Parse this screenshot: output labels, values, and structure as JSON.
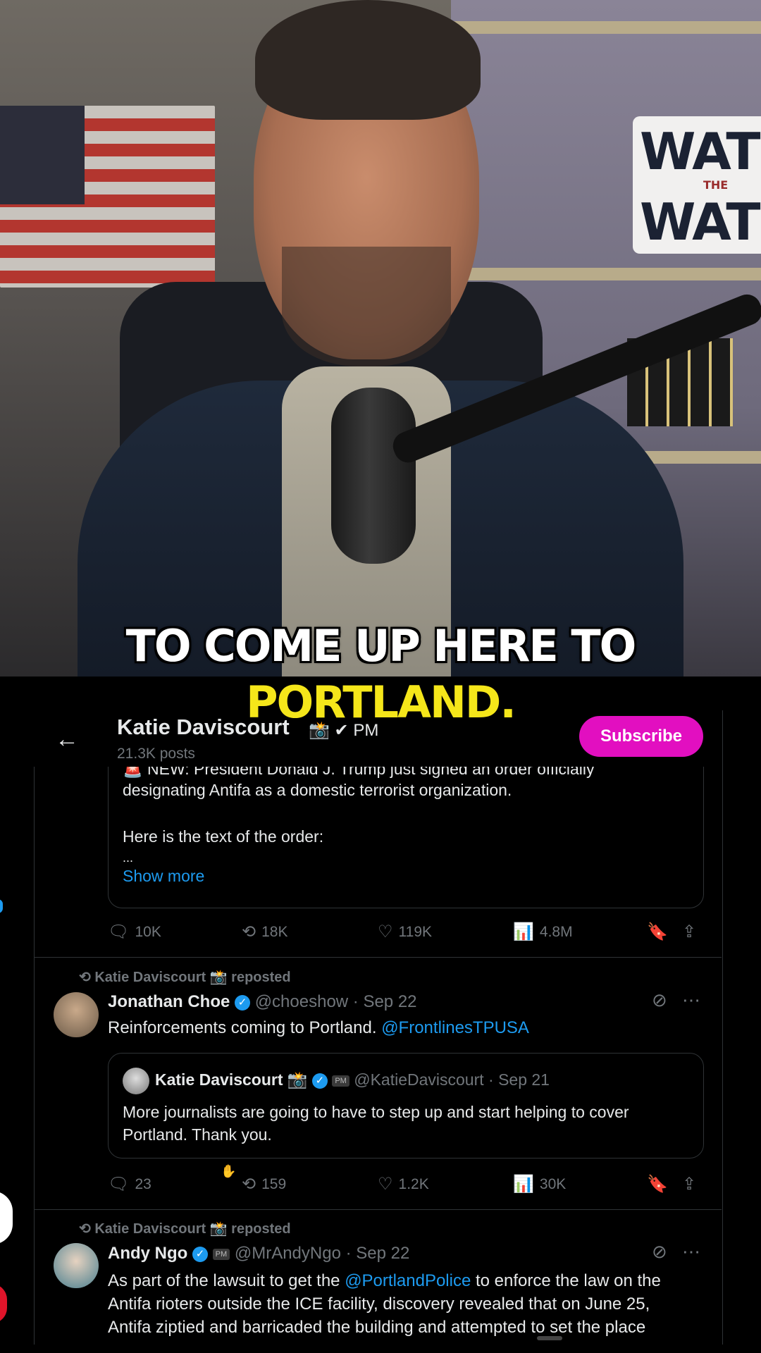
{
  "video": {
    "caption_line1": "TO COME UP HERE TO",
    "caption_line2": "PORTLAND.",
    "sign_line1": "WATCH",
    "sign_line2": "THE",
    "sign_line3": "WATCH"
  },
  "profile": {
    "name": "Katie Daviscourt",
    "badges": "📸 ✔ PM",
    "posts": "21.3K posts",
    "subscribe_label": "Subscribe"
  },
  "post1": {
    "quote_line0": "🚨 NEW: President Donald J. Trump just signed an order officially",
    "quote_line1": "designating Antifa as a domestic terrorist organization.",
    "quote_line2": "Here is the text of the order:",
    "quote_line3": "...",
    "show_more": "Show more",
    "replies": "10K",
    "reposts": "18K",
    "likes": "119K",
    "views": "4.8M"
  },
  "post2": {
    "repost_label": "Katie Daviscourt 📸 reposted",
    "author": "Jonathan Choe",
    "handle_date": "@choeshow · Sep 22",
    "text_before": "Reinforcements coming to Portland. ",
    "mention": "@FrontlinesTPUSA",
    "quote_author": "Katie Daviscourt 📸",
    "quote_handle_date": "@KatieDaviscourt · Sep 21",
    "quote_text_line1": "More journalists are going to have to step up and start helping to cover",
    "quote_text_line2": "Portland. Thank you.",
    "replies": "23",
    "reposts": "159",
    "likes": "1.2K",
    "views": "30K"
  },
  "post3": {
    "repost_label": "Katie Daviscourt 📸 reposted",
    "author": "Andy Ngo",
    "handle_date": "@MrAndyNgo · Sep 22",
    "text_l1_before": "As part of the lawsuit to get the ",
    "text_l1_mention": "@PortlandPolice",
    "text_l1_after": " to enforce the law on the",
    "text_l2": "Antifa rioters outside the ICE facility, discovery revealed that on June 25,",
    "text_l3": "Antifa ziptied and barricaded the building and attempted to set the place"
  },
  "icons": {
    "back": "←",
    "reply": "🗨",
    "repost": "⟲",
    "like": "♡",
    "views": "📊",
    "bookmark": "🔖",
    "share": "⇪",
    "grok": "⊘",
    "more": "⋯"
  }
}
